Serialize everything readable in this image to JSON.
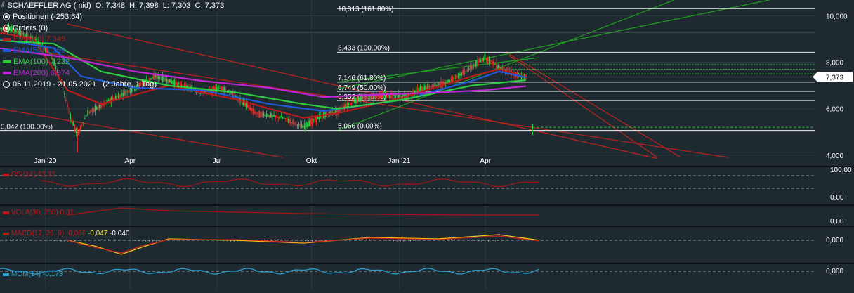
{
  "header": {
    "icon": "chart-type-icon",
    "symbol": "SCHAEFFLER AG (mid)",
    "ohlc": "O: 7,348  H: 7,398  L: 7,303  C: 7,373"
  },
  "legend": {
    "positions": "Positionen (-253,64)",
    "orders": "Orders (0)",
    "range": "06.11.2019 - 21.05.2021   (2 Jahre, 1 Tag)",
    "ema": [
      {
        "label": "EMA(20)",
        "value": "7,349",
        "color": "#b71c1c"
      },
      {
        "label": "EMA(50)",
        "value": "7,356",
        "color": "#1e5bd8"
      },
      {
        "label": "EMA(100)",
        "value": "7,232",
        "color": "#2ecc40"
      },
      {
        "label": "EMA(200)",
        "value": "6,974",
        "color": "#c026d3"
      }
    ]
  },
  "price_badge": "7,373",
  "fib_labels": [
    "10,313 (161.80%)",
    "8,433 (100.00%)",
    "7,146 (61.80%)",
    "6,749 (50.00%)",
    "6,352 (38.20%)",
    "5,066 (0.00%)",
    "5,042 (100.00%)"
  ],
  "indicators": {
    "rsi": {
      "label": "RSI(14)",
      "value": "43,33",
      "axis": [
        "100,00",
        "0,00"
      ]
    },
    "vola": {
      "label": "VOLA(30, 250)",
      "value": "0,31",
      "axis": [
        "0,00"
      ]
    },
    "macd": {
      "label": "MACD(12, 26, 9)",
      "v1": "-0,086",
      "v2": "-0,047",
      "v3": "-0,040",
      "axis": [
        "0,000"
      ]
    },
    "mom": {
      "label": "MOM(14)",
      "value": "-0,173",
      "axis": [
        "0,000"
      ]
    }
  },
  "chart_data": {
    "type": "candlestick",
    "x_ticks": [
      "Jan '20",
      "Apr",
      "Jul",
      "Okt",
      "Jan '21",
      "Apr"
    ],
    "y_ticks": [
      "10,000",
      "8,000",
      "6,000",
      "4,000"
    ],
    "ylim": [
      3.5,
      10.6
    ],
    "last_close": 7.373,
    "price_path": [
      [
        -0.04,
        9.6
      ],
      [
        0.02,
        9.4
      ],
      [
        0.05,
        9.0
      ],
      [
        0.075,
        8.4
      ],
      [
        0.09,
        7.2
      ],
      [
        0.105,
        5.6
      ],
      [
        0.115,
        4.9
      ],
      [
        0.13,
        5.8
      ],
      [
        0.16,
        6.3
      ],
      [
        0.2,
        6.9
      ],
      [
        0.23,
        7.4
      ],
      [
        0.26,
        7.1
      ],
      [
        0.3,
        6.7
      ],
      [
        0.33,
        6.9
      ],
      [
        0.36,
        6.3
      ],
      [
        0.38,
        5.8
      ],
      [
        0.42,
        5.6
      ],
      [
        0.45,
        5.2
      ],
      [
        0.47,
        5.6
      ],
      [
        0.5,
        5.9
      ],
      [
        0.53,
        6.4
      ],
      [
        0.57,
        6.6
      ],
      [
        0.6,
        6.5
      ],
      [
        0.63,
        6.9
      ],
      [
        0.66,
        7.1
      ],
      [
        0.69,
        7.6
      ],
      [
        0.72,
        8.2
      ],
      [
        0.74,
        7.8
      ],
      [
        0.77,
        7.4
      ],
      [
        0.78,
        7.373
      ]
    ],
    "ema": [
      {
        "name": "EMA(20)",
        "color": "#b71c1c",
        "points": [
          [
            -0.04,
            9.5
          ],
          [
            0.05,
            9.0
          ],
          [
            0.1,
            6.8
          ],
          [
            0.15,
            6.2
          ],
          [
            0.25,
            7.0
          ],
          [
            0.35,
            6.4
          ],
          [
            0.45,
            5.6
          ],
          [
            0.5,
            5.8
          ],
          [
            0.6,
            6.5
          ],
          [
            0.7,
            7.4
          ],
          [
            0.74,
            7.7
          ],
          [
            0.78,
            7.349
          ]
        ]
      },
      {
        "name": "EMA(50)",
        "color": "#1e5bd8",
        "points": [
          [
            -0.04,
            9.2
          ],
          [
            0.08,
            8.6
          ],
          [
            0.12,
            7.4
          ],
          [
            0.2,
            6.9
          ],
          [
            0.3,
            6.8
          ],
          [
            0.4,
            6.2
          ],
          [
            0.48,
            5.9
          ],
          [
            0.6,
            6.4
          ],
          [
            0.7,
            7.2
          ],
          [
            0.74,
            7.6
          ],
          [
            0.78,
            7.356
          ]
        ]
      },
      {
        "name": "EMA(100)",
        "color": "#2ecc40",
        "points": [
          [
            -0.04,
            9.0
          ],
          [
            0.08,
            8.8
          ],
          [
            0.15,
            7.6
          ],
          [
            0.25,
            7.0
          ],
          [
            0.35,
            6.7
          ],
          [
            0.45,
            6.2
          ],
          [
            0.5,
            6.0
          ],
          [
            0.6,
            6.4
          ],
          [
            0.7,
            7.0
          ],
          [
            0.78,
            7.232
          ]
        ]
      },
      {
        "name": "EMA(200)",
        "color": "#c026d3",
        "points": [
          [
            0.0,
            8.6
          ],
          [
            0.1,
            8.2
          ],
          [
            0.2,
            7.6
          ],
          [
            0.3,
            7.2
          ],
          [
            0.4,
            6.9
          ],
          [
            0.48,
            6.5
          ],
          [
            0.55,
            6.6
          ],
          [
            0.65,
            6.7
          ],
          [
            0.72,
            6.8
          ],
          [
            0.78,
            6.974
          ]
        ]
      }
    ],
    "fib_levels": [
      10.313,
      9.3,
      8.433,
      7.146,
      6.749,
      6.352,
      5.066
    ]
  },
  "colors": {
    "bg": "#1e2a30",
    "bull": "#2ecc40",
    "bear": "#e03131",
    "trend_red": "#c0221f",
    "trend_green": "#1fa01f"
  }
}
